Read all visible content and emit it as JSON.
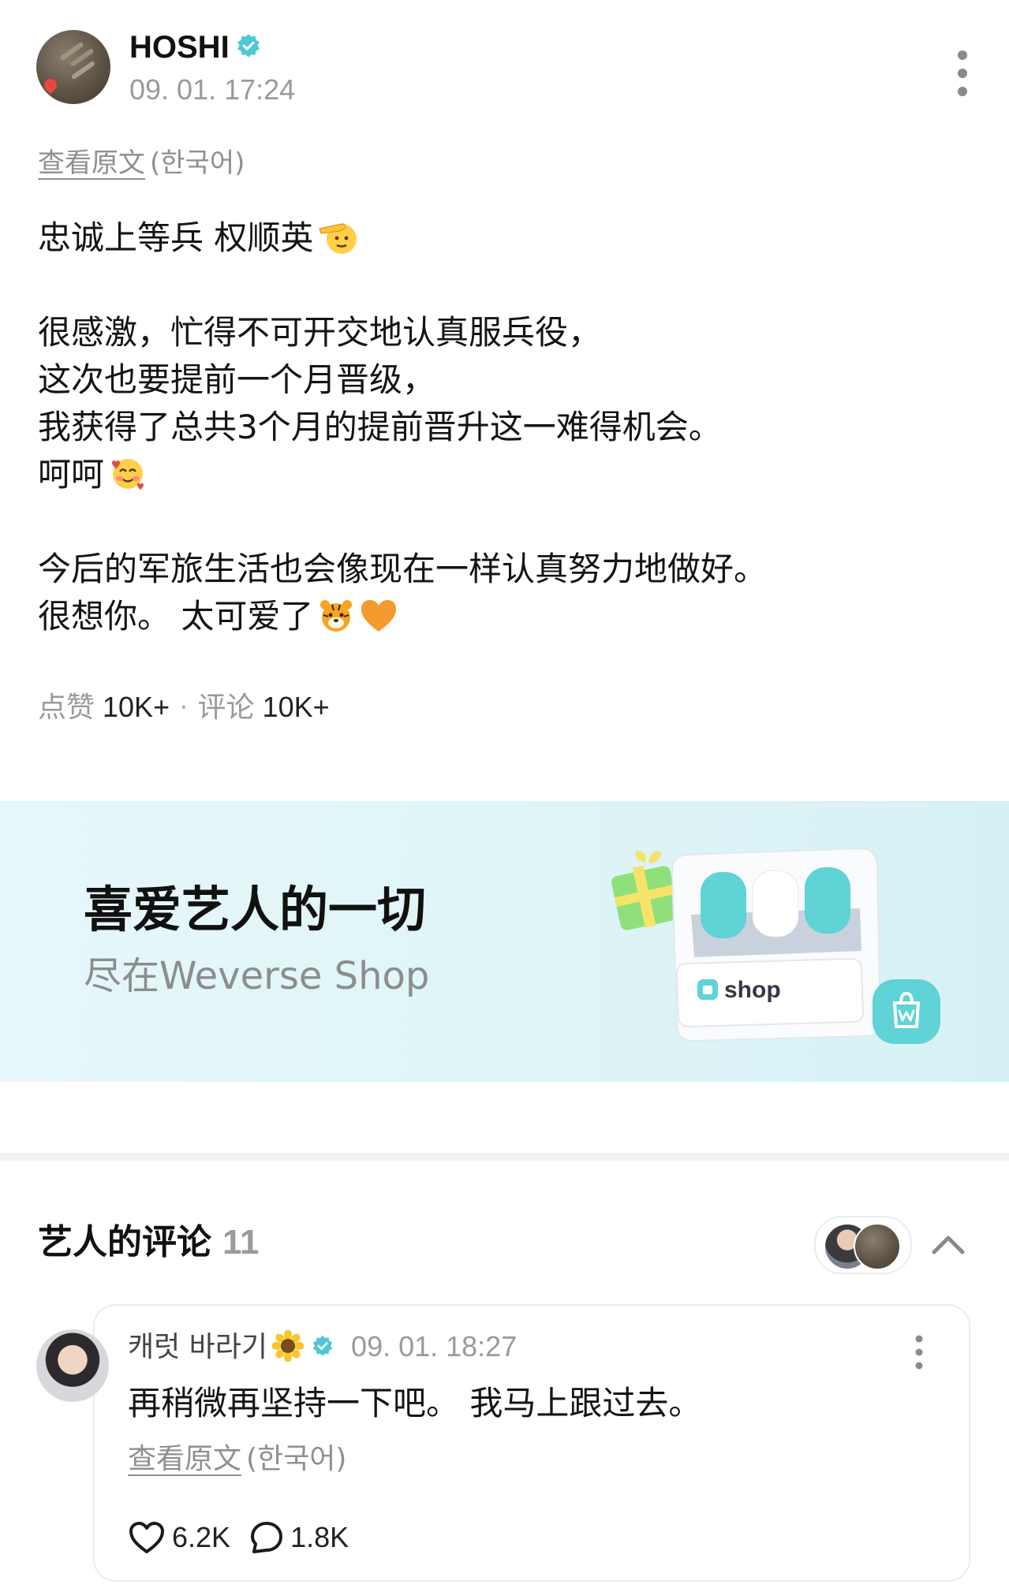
{
  "post": {
    "author": "HOSHI",
    "timestamp": "09. 01. 17:24",
    "translate_link": "查看原文",
    "translate_lang": "(한국어)",
    "lines": [
      "忠诚上等兵 权顺英",
      "",
      "很感激，忙得不可开交地认真服兵役，",
      "这次也要提前一个月晋级，",
      "我获得了总共3个月的提前晋升这一难得机会。",
      "呵呵",
      "",
      "今后的军旅生活也会像现在一样认真努力地做好。",
      "很想你。 太可爱了"
    ],
    "icons": {
      "verified": "verified-badge-icon",
      "more": "more-vertical-icon",
      "salute": "saluting-face-emoji",
      "smile_hearts": "smiling-face-with-hearts-emoji",
      "tiger": "tiger-face-emoji",
      "orange_heart": "orange-heart-emoji"
    }
  },
  "stats": {
    "likes_label": "点赞",
    "likes_value": "10K+",
    "separator": "·",
    "comments_label": "评论",
    "comments_value": "10K+"
  },
  "banner": {
    "title": "喜爱艺人的一切",
    "subtitle": "尽在Weverse Shop",
    "art_label": "shop",
    "bg_color": "#dff5f7",
    "accent_color": "#5fd3d6"
  },
  "artist_comments": {
    "title": "艺人的评论",
    "count": "11",
    "comment": {
      "author": "캐럿 바라기",
      "author_emoji": "sunflower-emoji",
      "timestamp": "09. 01. 18:27",
      "text": "再稍微再坚持一下吧。 我马上跟过去。",
      "translate_link": "查看原文",
      "translate_lang": "(한국어)",
      "likes": "6.2K",
      "replies": "1.8K"
    }
  },
  "colors": {
    "verified": "#4fc7d6",
    "muted_text": "#9a9a9a",
    "text": "#141414"
  }
}
